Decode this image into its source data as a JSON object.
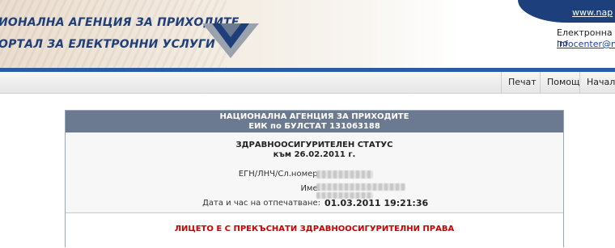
{
  "header": {
    "agency_title": "ИОНАЛНА АГЕНЦИЯ ЗА ПРИХОДИТЕ",
    "portal_title": "ОРТАЛ ЗА ЕЛЕКТРОННИ УСЛУГИ",
    "top_right_link": "www.nap",
    "eservices_label": "Електронна по",
    "email": "infocenter@nra"
  },
  "toolbar": {
    "print": "Печат",
    "help": "Помощ",
    "home": "Начало"
  },
  "document": {
    "agency": "НАЦИОНАЛНА АГЕНЦИЯ ЗА ПРИХОДИТЕ",
    "eik": "ЕИК по БУЛСТАТ 131063188",
    "title": "ЗДРАВНООСИГУРИТЕЛЕН СТАТУС",
    "date": "към 26.02.2011 г.",
    "egn_label": "ЕГН/ЛНЧ/Сл.номер:",
    "name_label": "Име:",
    "printed_label": "Дата и час на отпечатване:",
    "printed_value": "01.03.2011 19:21:36",
    "status_message": "ЛИЦЕТО Е С ПРЕКЪСНАТИ ЗДРАВНООСИГУРИТЕЛНИ ПРАВА"
  }
}
